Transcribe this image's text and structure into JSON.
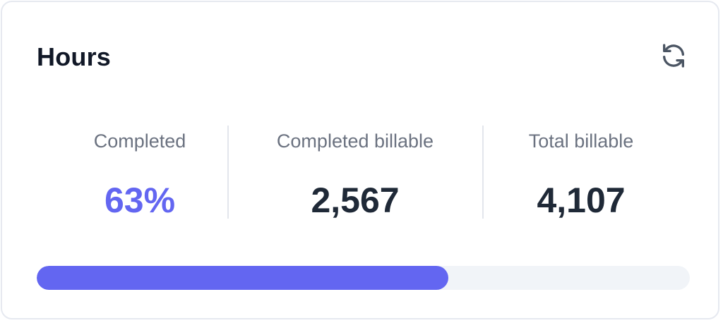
{
  "card": {
    "title": "Hours",
    "refresh_icon": "refresh-icon"
  },
  "stats": [
    {
      "label": "Completed",
      "value": "63%",
      "accent": "#6366f1"
    },
    {
      "label": "Completed billable",
      "value": "2,567"
    },
    {
      "label": "Total billable",
      "value": "4,107"
    }
  ],
  "progress": {
    "percent": 63,
    "fill_color": "#6366f1",
    "track_color": "#f1f4f8"
  }
}
